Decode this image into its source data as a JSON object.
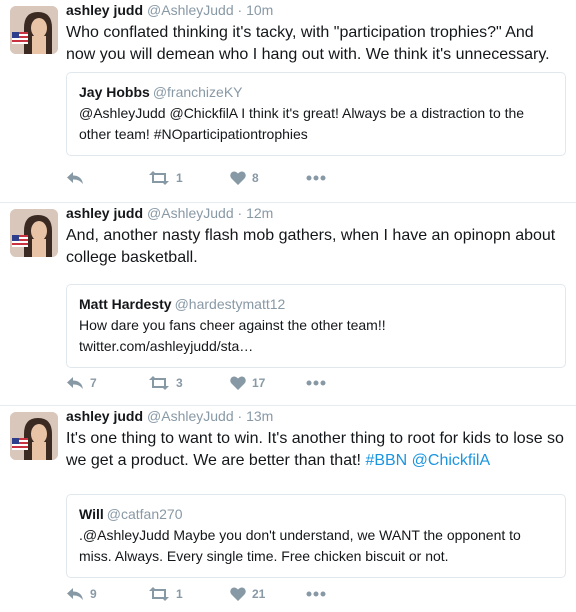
{
  "colors": {
    "hashtag": "#1b95e0",
    "muted": "#8899a6",
    "border": "#e1e8ed"
  },
  "icons": [
    "reply-icon",
    "retweet-icon",
    "like-icon",
    "more-icon",
    "avatar-flag-icon"
  ],
  "tweets": [
    {
      "name": "ashley judd",
      "handle": "@AshleyJudd",
      "sep": "·",
      "time": "10m",
      "text_plain": "Who conflated thinking it's tacky, with \"participation trophies?\"  And now you will demean who I hang out with. We think it's unnecessary.",
      "text_hashtags": "",
      "quote": {
        "name": "Jay Hobbs",
        "handle": "@franchizeKY",
        "text": "@AshleyJudd @ChickfilA I think it's great! Always be a distraction to the other team! #NOparticipationtrophies"
      },
      "replies": "",
      "retweets": "1",
      "likes": "8"
    },
    {
      "name": "ashley judd",
      "handle": "@AshleyJudd",
      "sep": "·",
      "time": "12m",
      "text_plain": "And, another nasty flash mob gathers, when I have an opinopn about college basketball.",
      "text_hashtags": "",
      "quote": {
        "name": "Matt Hardesty",
        "handle": "@hardestymatt12",
        "text": "How dare you fans cheer against the other team!! twitter.com/ashleyjudd/sta…"
      },
      "replies": "7",
      "retweets": "3",
      "likes": "17"
    },
    {
      "name": "ashley judd",
      "handle": "@AshleyJudd",
      "sep": "·",
      "time": "13m",
      "text_plain": "It's one thing to want to win. It's another thing to root for kids to lose so we get a product.  We are better than that! ",
      "text_hashtags": "#BBN @ChickfilA",
      "quote": {
        "name": "Will",
        "handle": "@catfan270",
        "text": ".@AshleyJudd Maybe you don't understand, we WANT the opponent to miss. Always. Every single time. Free chicken biscuit or not."
      },
      "replies": "9",
      "retweets": "1",
      "likes": "21"
    }
  ]
}
